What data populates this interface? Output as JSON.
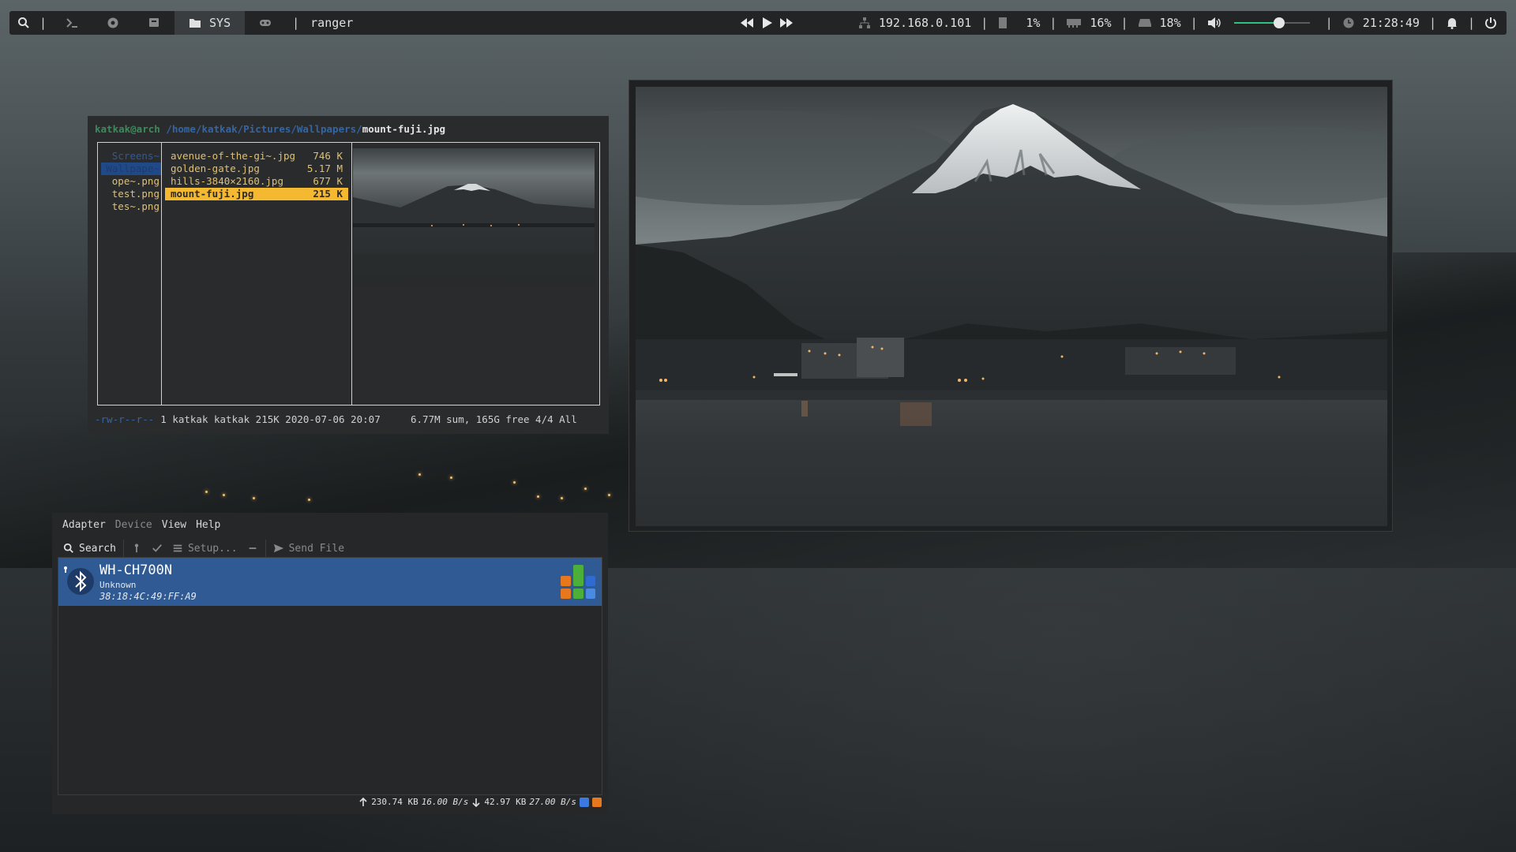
{
  "colors": {
    "accent_green": "#2ec27e",
    "selection_yellow": "#f5b831",
    "bt_selection_blue": "#2f5a93",
    "ranger_dir_blue": "#3465a4"
  },
  "topbar": {
    "icons": [
      "search-icon",
      "terminal-icon",
      "browser-icon",
      "chat-icon",
      "folder-icon",
      "gamepad-icon"
    ],
    "active_workspace": "SYS",
    "window_title": "ranger",
    "network": "192.168.0.101",
    "cpu": "1%",
    "memory": "16%",
    "disk": "18%",
    "volume_fraction": 0.6,
    "clock": "21:28:49"
  },
  "ranger": {
    "user_host": "katkak@arch",
    "path": "/home/katkak/Pictures/Wallpapers/",
    "current_file": "mount-fuji.jpg",
    "parent_entries": [
      {
        "name": "Screens~",
        "is_dir": true,
        "selected": false
      },
      {
        "name": "Wallpape~",
        "is_dir": true,
        "selected": true
      },
      {
        "name": "ope~.png",
        "is_dir": false,
        "selected": false
      },
      {
        "name": "test.png",
        "is_dir": false,
        "selected": false
      },
      {
        "name": "tes~.png",
        "is_dir": false,
        "selected": false
      }
    ],
    "files": [
      {
        "name": "avenue-of-the-gi~.jpg",
        "size": "746 K",
        "selected": false
      },
      {
        "name": "golden-gate.jpg",
        "size": "5.17 M",
        "selected": false
      },
      {
        "name": "hills-3840×2160.jpg",
        "size": "677 K",
        "selected": false
      },
      {
        "name": "mount-fuji.jpg",
        "size": "215 K",
        "selected": true
      }
    ],
    "status_perm": "-rw-r--r--",
    "status_meta": "1 katkak katkak 215K 2020-07-06 20:07",
    "status_right": "6.77M sum, 165G free  4/4  All"
  },
  "bluetooth": {
    "menu": [
      {
        "label": "Adapter",
        "enabled": true
      },
      {
        "label": "Device",
        "enabled": false
      },
      {
        "label": "View",
        "enabled": true
      },
      {
        "label": "Help",
        "enabled": true
      }
    ],
    "toolbar": {
      "search": "Search",
      "setup": "Setup...",
      "send_file": "Send File"
    },
    "device": {
      "name": "WH-CH700N",
      "type": "Unknown",
      "mac": "38:18:4C:49:FF:A9"
    },
    "status": {
      "up_total": "230.74 KB",
      "up_rate": "16.00 B/s",
      "down_total": "42.97 KB",
      "down_rate": "27.00 B/s"
    }
  }
}
